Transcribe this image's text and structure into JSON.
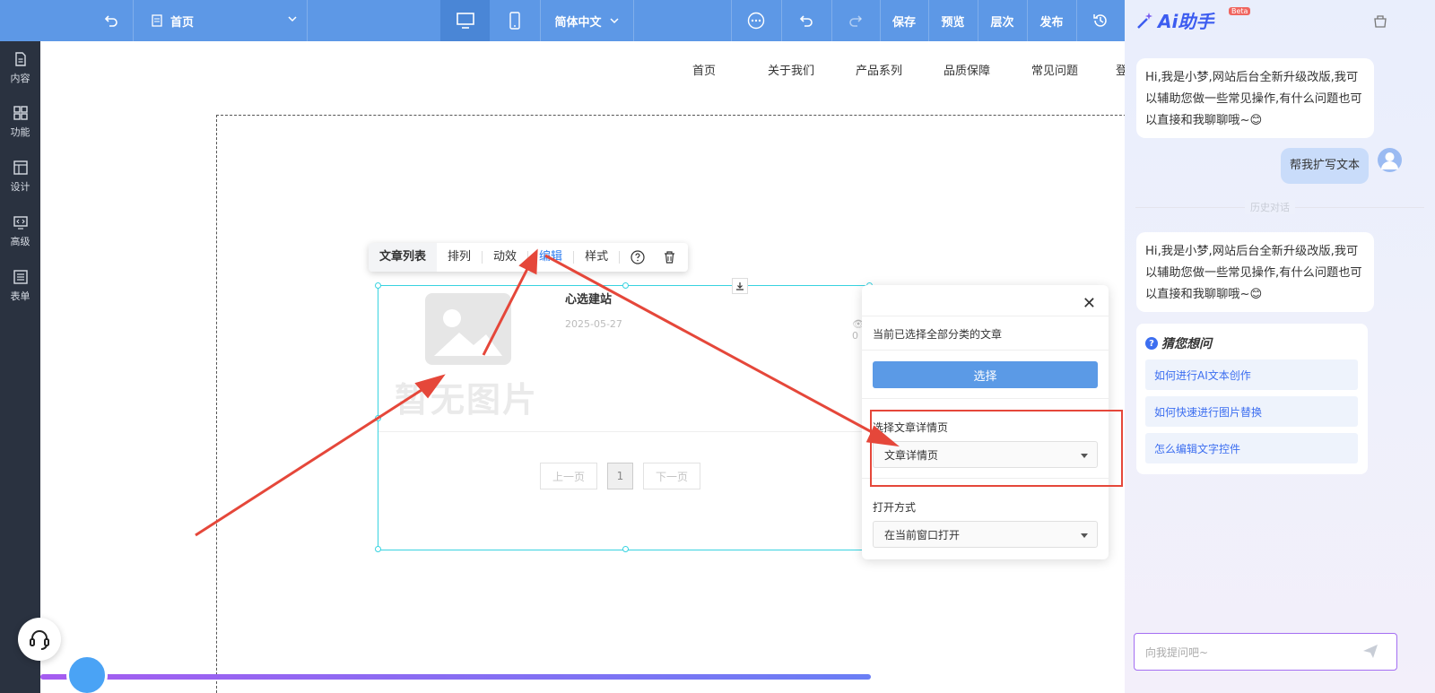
{
  "toolbar": {
    "page_name": "首页",
    "language": "简体中文",
    "save": "保存",
    "preview": "预览",
    "layers": "层次",
    "publish": "发布"
  },
  "sidebar": {
    "items": [
      {
        "label": "内容"
      },
      {
        "label": "功能"
      },
      {
        "label": "设计"
      },
      {
        "label": "高级"
      },
      {
        "label": "表单"
      }
    ]
  },
  "site_nav": [
    "首页",
    "关于我们",
    "产品系列",
    "品质保障",
    "常见问题",
    "登"
  ],
  "widget_toolbar": {
    "type": "文章列表",
    "arrange": "排列",
    "effects": "动效",
    "edit": "编辑",
    "style": "样式"
  },
  "article": {
    "placeholder_text": "暂无图片",
    "title": "心选建站",
    "date": "2025-05-27",
    "views": "0"
  },
  "pager": {
    "prev": "上一页",
    "current": "1",
    "next": "下一页"
  },
  "edit_panel": {
    "info": "当前已选择全部分类的文章",
    "select_button": "选择",
    "detail_label": "选择文章详情页",
    "detail_value": "文章详情页",
    "open_label": "打开方式",
    "open_value": "在当前窗口打开"
  },
  "ai": {
    "title": "Ai助手",
    "beta": "Beta",
    "greeting_1": "Hi,我是小梦,网站后台全新升级改版,我可以辅助您做一些常见操作,有什么问题也可以直接和我聊聊哦~😊",
    "user_message": "帮我扩写文本",
    "history_label": "历史对话",
    "greeting_2": "Hi,我是小梦,网站后台全新升级改版,我可以辅助您做一些常见操作,有什么问题也可以直接和我聊聊哦~😊",
    "guess_title": "猜您想问",
    "questions": [
      "如何进行AI文本创作",
      "如何快速进行图片替换",
      "怎么编辑文字控件"
    ],
    "input_placeholder": "向我提问吧~"
  },
  "colors": {
    "toolbar": "#5d98e6",
    "sidebar": "#2a3240",
    "annotation_red": "#e5473a",
    "selection": "#38d3e0"
  }
}
